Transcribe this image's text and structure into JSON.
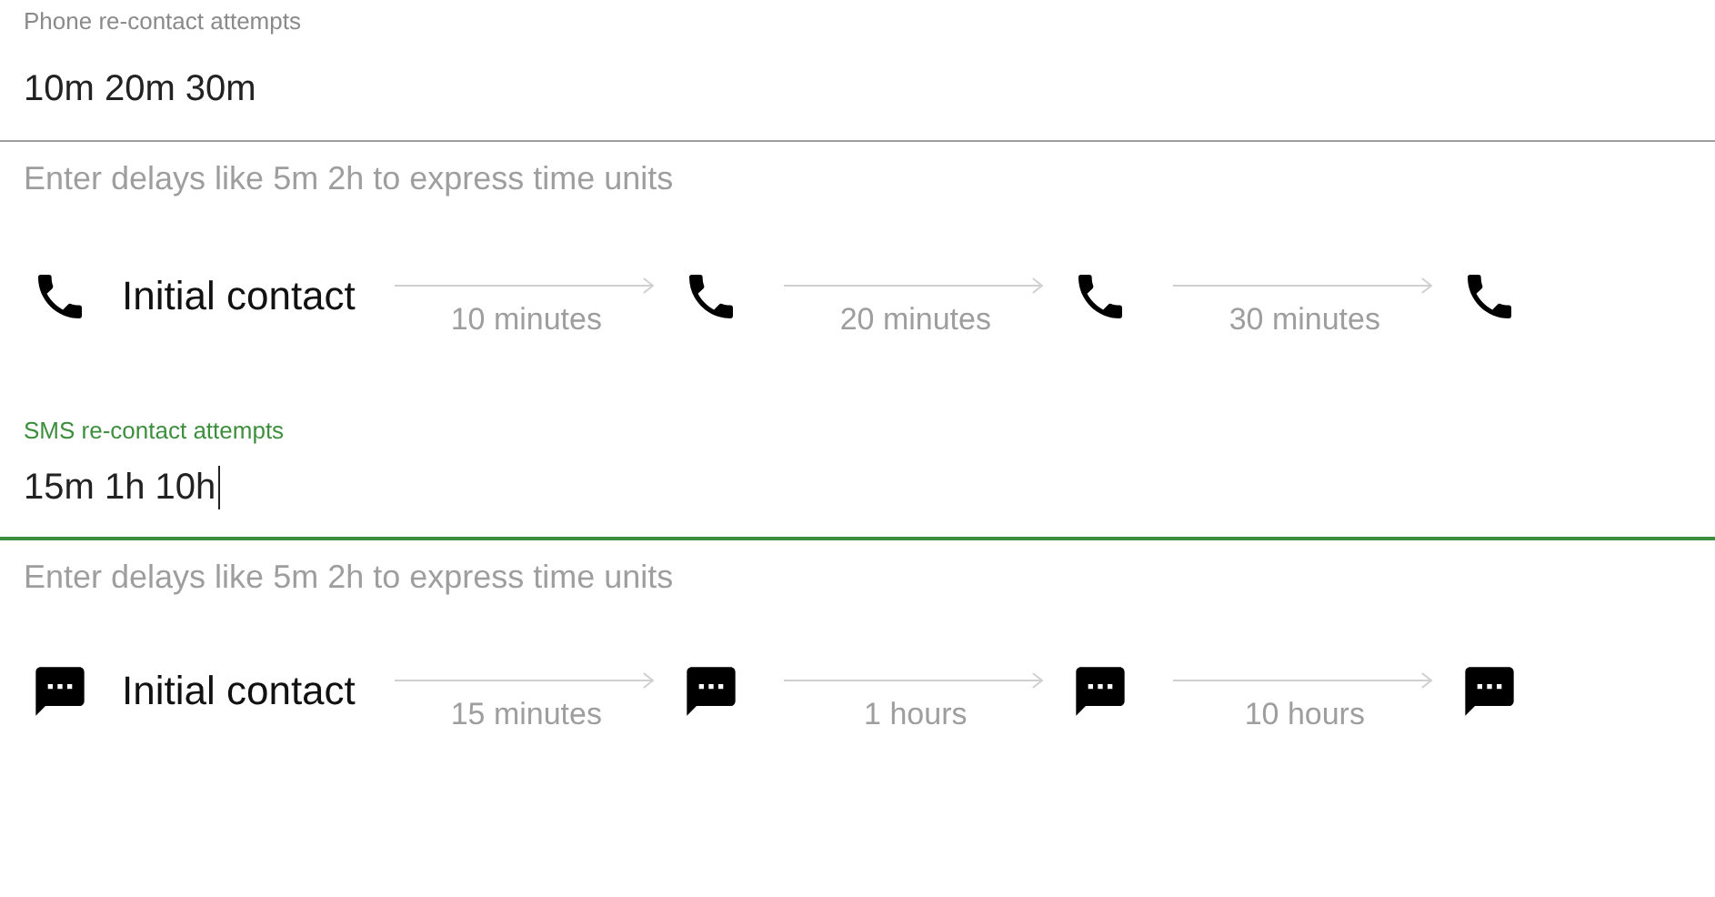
{
  "sections": [
    {
      "kind": "phone",
      "label": "Phone re-contact attempts",
      "value": "10m 20m 30m",
      "focused": false,
      "hint": "Enter delays like 5m 2h to express time units",
      "timeline": {
        "start": "Initial contact",
        "steps": [
          "10 minutes",
          "20 minutes",
          "30 minutes"
        ]
      }
    },
    {
      "kind": "sms",
      "label": "SMS re-contact attempts",
      "value": "15m 1h 10h",
      "focused": true,
      "hint": "Enter delays like 5m 2h to express time units",
      "timeline": {
        "start": "Initial contact",
        "steps": [
          "15 minutes",
          "1 hours",
          "10 hours"
        ]
      }
    }
  ]
}
